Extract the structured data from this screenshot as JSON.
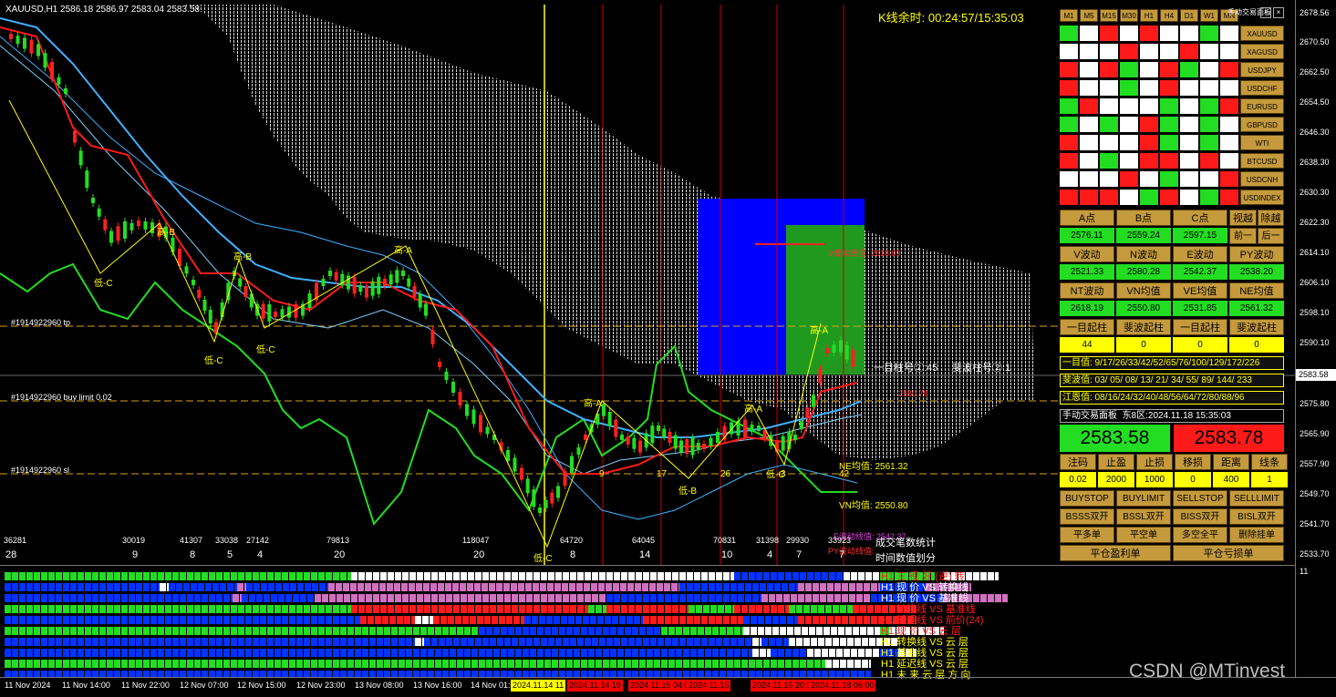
{
  "window": {
    "title": "XAUUSD,H1  2586.18 2586.97 2583.04 2583.58",
    "ktimer": "K线余时:  00:24:57/15:35:03"
  },
  "price_axis": {
    "ticks": [
      "2678.56",
      "2670.50",
      "2662.50",
      "2654.50",
      "2646.30",
      "2638.30",
      "2630.30",
      "2622.30",
      "2614.10",
      "2606.10",
      "2598.10",
      "2590.10",
      "2575.80",
      "2565.90",
      "2557.90",
      "2549.70",
      "2541.70",
      "2533.70"
    ],
    "current": "2583.58",
    "lower_tick": "11"
  },
  "chart_labels": {
    "order_tp": "#1914922960 tp",
    "order_buy_limit": "#1914922960 buy limit 0.02",
    "order_sl": "#1914922960 sl",
    "zigzag": [
      "低-C",
      "高-B",
      "低-C",
      "高-B",
      "低-C",
      "高-A",
      "低-C",
      "高-A",
      "低-B",
      "高-A",
      "低-C",
      "高-A"
    ],
    "bar_numbers": [
      "9",
      "17",
      "26",
      "3",
      "42"
    ],
    "ne_label": "NE均值:  2561.32",
    "vn_label": "VN均值:  2550.80",
    "e_wave_label": "E波动线值:  2542.37",
    "py_label": "PY波动线值:",
    "red_target": "V波动线值:  2618.09",
    "red_mid": "2580.78",
    "ichimoku_label": "一目柱号②:45",
    "fibo_label": "斐波柱号②:1",
    "trade_count": "成交笔数统计",
    "time_div": "时间数值划分"
  },
  "volume_row": [
    "36281",
    "30019",
    "41307",
    "33038",
    "27142",
    "79813",
    "118047",
    "64720",
    "64045",
    "70831",
    "31398",
    "29930",
    "33923"
  ],
  "count_row": [
    "28",
    "9",
    "8",
    "5",
    "4",
    "20",
    "20",
    "8",
    "14",
    "10",
    "4",
    "7",
    "7"
  ],
  "panel": {
    "title": "手动交易面板",
    "controls": [
      "-",
      "□",
      "×"
    ],
    "timeframes": [
      "M1",
      "M5",
      "M15",
      "M30",
      "H1",
      "H4",
      "D1",
      "W1",
      "MN"
    ],
    "symbols": [
      "XAUUSD",
      "XAGUSD",
      "USDJPY",
      "USDCHF",
      "EURUSD",
      "GBPUSD",
      "WTI",
      "BTCUSD",
      "USDCNH",
      "USDINDEX"
    ],
    "grid_colors": [
      [
        "g",
        "w",
        "r",
        "w",
        "r",
        "w",
        "w",
        "g",
        "w"
      ],
      [
        "w",
        "w",
        "w",
        "r",
        "w",
        "w",
        "r",
        "w",
        "w"
      ],
      [
        "r",
        "w",
        "r",
        "g",
        "w",
        "r",
        "g",
        "w",
        "r"
      ],
      [
        "r",
        "w",
        "w",
        "g",
        "w",
        "r",
        "w",
        "w",
        "w"
      ],
      [
        "g",
        "r",
        "w",
        "w",
        "w",
        "g",
        "w",
        "g",
        "r"
      ],
      [
        "g",
        "w",
        "g",
        "w",
        "r",
        "g",
        "w",
        "g",
        "w"
      ],
      [
        "r",
        "w",
        "w",
        "w",
        "r",
        "g",
        "w",
        "g",
        "w"
      ],
      [
        "r",
        "w",
        "g",
        "w",
        "r",
        "r",
        "w",
        "r",
        "w"
      ],
      [
        "w",
        "w",
        "w",
        "r",
        "w",
        "g",
        "w",
        "w",
        "r"
      ],
      [
        "r",
        "r",
        "r",
        "w",
        "g",
        "r",
        "w",
        "g",
        "r"
      ]
    ],
    "points_labels": [
      "A点",
      "B点",
      "C点",
      "视越",
      "除越"
    ],
    "points_values": [
      "2576.11",
      "2559.24",
      "2597.15",
      "前一",
      "后一"
    ],
    "wave_labels": [
      "V波动",
      "N波动",
      "E波动",
      "PY波动"
    ],
    "wave_values": [
      "2521.33",
      "2580.28",
      "2542.37",
      "2538.20"
    ],
    "avg_labels": [
      "NT波动",
      "VN均值",
      "VE均值",
      "NE均值"
    ],
    "avg_values": [
      "2618.19",
      "2550.80",
      "2531.85",
      "2561.32"
    ],
    "start_labels": [
      "一目起柱",
      "斐波起柱",
      "一目起柱",
      "斐波起柱"
    ],
    "start_values": [
      "44",
      "0",
      "0",
      "0"
    ],
    "seq_ichimoku": "一目值:  9/17/26/33/42/52/65/76/100/129/172/226",
    "seq_fibo": "斐波值:  03/ 05/ 08/ 13/ 21/ 34/ 55/ 89/ 144/ 233",
    "seq_jiang": "江恩值:  08/16/24/32/40/48/56/64/72/80/88/96",
    "panel_header": "手动交易面板",
    "zone_time": "东8区:2024.11.18 15:35:03",
    "bid": "2583.58",
    "ask": "2583.78",
    "order_labels": [
      "注码",
      "止盈",
      "止损",
      "移损",
      "距离",
      "线条"
    ],
    "order_values": [
      "0.02",
      "2000",
      "1000",
      "0",
      "400",
      "1"
    ],
    "action_row1": [
      "BUYSTOP",
      "BUYLIMIT",
      "SELLSTOP",
      "SELLLIMIT"
    ],
    "action_row2": [
      "BSSS双开",
      "BSSL双开",
      "BISS双开",
      "BISL双开"
    ],
    "action_row3": [
      "平多单",
      "平空单",
      "多空全平",
      "删除挂单"
    ],
    "action_row4": [
      "平仓盈利单",
      "平仓亏损单"
    ]
  },
  "lower_labels": [
    {
      "text": "H1 三 役 好 (逆) 转",
      "color": "#ff2020"
    },
    {
      "text": "H1 现  价 VS 转换线",
      "color": "#ffffff"
    },
    {
      "text": "H1 现  价 VS 基准线",
      "color": "#ffffff"
    },
    {
      "text": "H1 转换线 VS 基准线",
      "color": "#ff2020"
    },
    {
      "text": "H1 延迟线 VS 前价(24)",
      "color": "#ff2020"
    },
    {
      "text": "H1 现  价 VS 云  层",
      "color": "#ff2020"
    },
    {
      "text": "H1 转换线 VS 云  层",
      "color": "#ffff00"
    },
    {
      "text": "H1 基准线 VS 云  层",
      "color": "#ffff00"
    },
    {
      "text": "H1 延迟线 VS 云  层",
      "color": "#ffff00"
    },
    {
      "text": "H1 未 来  云 层 方 向",
      "color": "#ffff00"
    }
  ],
  "time_axis": [
    "11 Nov 2024",
    "11 Nov 14:00",
    "11 Nov 22:00",
    "12 Nov 07:00",
    "12 Nov 15:00",
    "12 Nov 23:00",
    "13 Nov 08:00",
    "13 Nov 16:00",
    "14 Nov 01:00"
  ],
  "time_badges": [
    {
      "text": "2024.11.14 11",
      "bg": "#ffff00",
      "fg": "#000"
    },
    {
      "text": "2024.11.14 19",
      "bg": "#ff0000",
      "fg": "#000"
    },
    {
      "text": "2024.11.15 04:0",
      "bg": "#ff0000",
      "fg": "#000"
    },
    {
      "text": "2024.11.15",
      "bg": "#ff0000",
      "fg": "#000"
    },
    {
      "text": "2024.11.15 20:0",
      "bg": "#ff0000",
      "fg": "#000"
    },
    {
      "text": "2024.11.18 06:00",
      "bg": "#ff0000",
      "fg": "#000"
    }
  ],
  "watermark": "CSDN @MTinvest",
  "colors": {
    "green": "#22dd22",
    "red": "#ff1a1a",
    "gold": "#c49a3c",
    "blue": "#0000ff",
    "cyan": "#40b0ff",
    "yellow": "#ffff00"
  }
}
